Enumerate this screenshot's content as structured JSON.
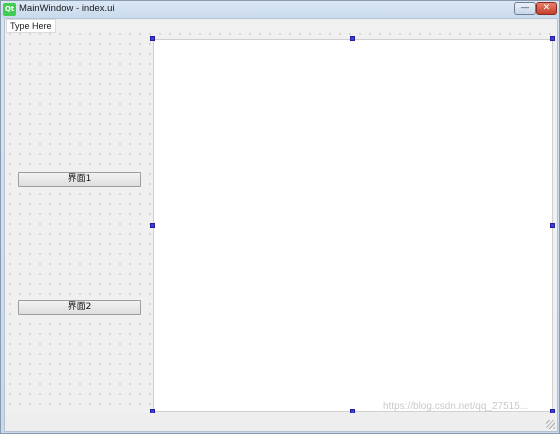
{
  "window": {
    "title": "MainWindow - index.ui",
    "app_logo_text": "Qt",
    "minimize_symbol": "—",
    "close_symbol": "✕"
  },
  "menubar": {
    "items": [
      {
        "label": "Type Here"
      }
    ]
  },
  "sidebar": {
    "buttons": [
      {
        "label": "界面1"
      },
      {
        "label": "界面2"
      }
    ]
  },
  "watermark": {
    "text": "https://blog.csdn.net/qq_27515..."
  },
  "colors": {
    "selection_handle": "#3b3bd6",
    "canvas_background": "#ffffff",
    "form_background": "#f0f0f0",
    "qt_logo": "#41cd52"
  },
  "icons": [
    "qt-logo-icon",
    "minimize-icon",
    "close-icon",
    "size-grip-icon"
  ]
}
